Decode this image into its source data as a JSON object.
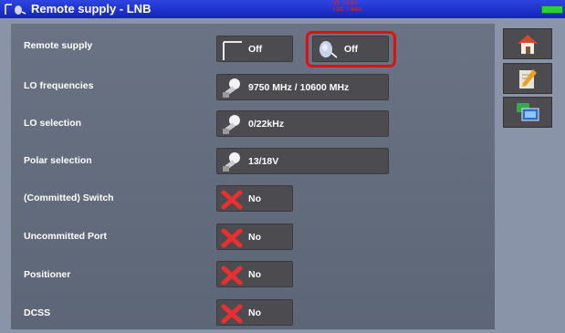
{
  "title_bar": {
    "title": "Remote supply - LNB",
    "status_text": "V0 = 0.0V\nI DC = 0mA"
  },
  "rows": [
    {
      "label": "Remote supply",
      "buttons": [
        {
          "value": "Off",
          "icon": "antenna-icon"
        },
        {
          "value": "Off",
          "icon": "satellite-dish-icon"
        }
      ]
    },
    {
      "label": "LO frequencies",
      "buttons": [
        {
          "value": "9750 MHz / 10600 MHz",
          "icon": "lnb-icon"
        }
      ]
    },
    {
      "label": "LO selection",
      "buttons": [
        {
          "value": "0/22kHz",
          "icon": "lnb-icon"
        }
      ]
    },
    {
      "label": "Polar selection",
      "buttons": [
        {
          "value": "13/18V",
          "icon": "lnb-icon"
        }
      ]
    },
    {
      "label": "(Committed) Switch",
      "buttons": [
        {
          "value": "No",
          "icon": "red-x-icon"
        }
      ]
    },
    {
      "label": "Uncommitted Port",
      "buttons": [
        {
          "value": "No",
          "icon": "red-x-icon"
        }
      ]
    },
    {
      "label": "Positioner",
      "buttons": [
        {
          "value": "No",
          "icon": "red-x-icon"
        }
      ]
    },
    {
      "label": "DCSS",
      "buttons": [
        {
          "value": "No",
          "icon": "red-x-icon"
        }
      ]
    }
  ],
  "side_buttons": [
    "home-icon",
    "edit-icon",
    "screen-icon"
  ],
  "colors": {
    "title_bar": "#1e33d0",
    "highlight": "#e01010",
    "battery": "#28d03a"
  }
}
